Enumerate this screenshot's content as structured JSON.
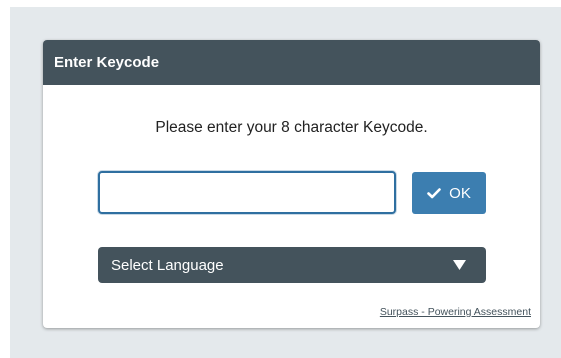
{
  "dialog": {
    "title": "Enter Keycode",
    "prompt": "Please enter your 8 character Keycode.",
    "keycode_input": {
      "value": "",
      "placeholder": ""
    },
    "ok_button": {
      "label": "OK",
      "icon": "checkmark-icon"
    },
    "language_select": {
      "label": "Select Language",
      "icon": "triangle-down-icon"
    },
    "footer_link": "Surpass - Powering Assessment"
  },
  "colors": {
    "header_bg": "#44535c",
    "accent": "#3c7eb0",
    "backdrop": "#e4e9ec"
  }
}
